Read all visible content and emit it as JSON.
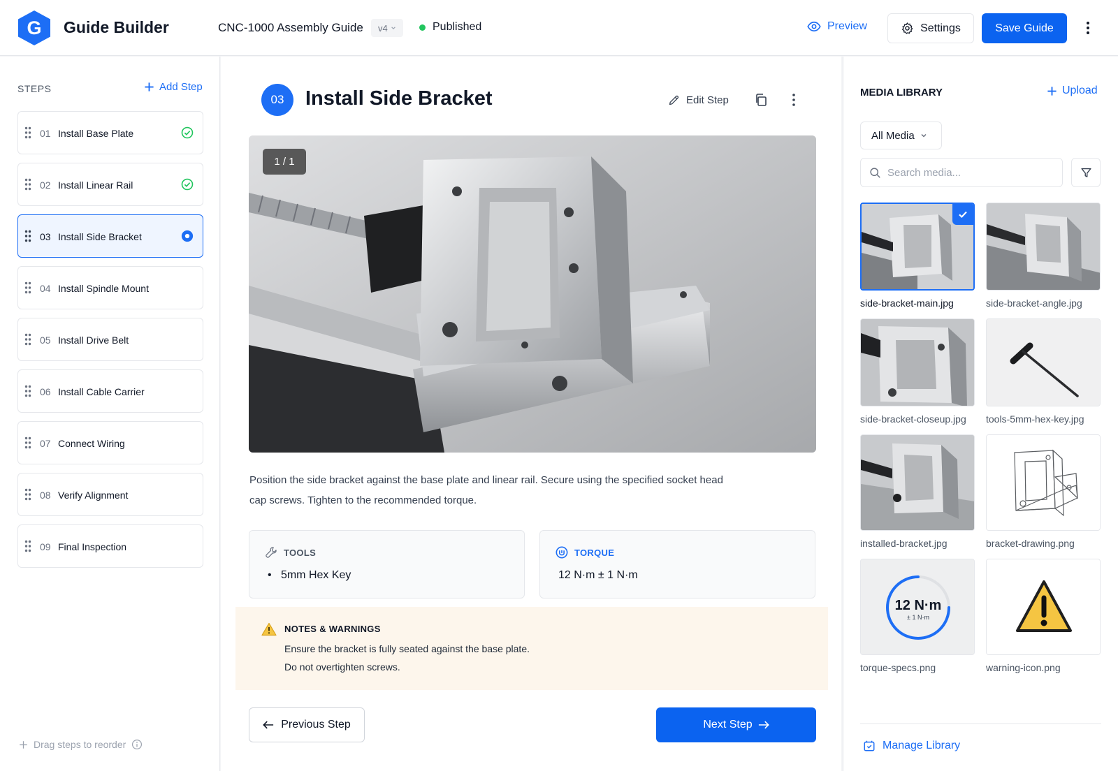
{
  "header": {
    "logo_letter": "G",
    "app_title": "Guide Builder",
    "doc_title": "CNC-1000 Assembly Guide",
    "version": "v4",
    "status": "Published",
    "preview_label": "Preview",
    "settings_label": "Settings",
    "save_label": "Save Guide"
  },
  "sidebar": {
    "title": "STEPS",
    "add_label": "Add Step",
    "steps": [
      {
        "num": "01",
        "label": "Install Base Plate",
        "state": "complete"
      },
      {
        "num": "02",
        "label": "Install Linear Rail",
        "state": "complete"
      },
      {
        "num": "03",
        "label": "Install Side Bracket",
        "state": "active"
      },
      {
        "num": "04",
        "label": "Install Spindle Mount",
        "state": "pending"
      },
      {
        "num": "05",
        "label": "Install Drive Belt",
        "state": "pending"
      },
      {
        "num": "06",
        "label": "Install Cable Carrier",
        "state": "pending"
      },
      {
        "num": "07",
        "label": "Connect Wiring",
        "state": "pending"
      },
      {
        "num": "08",
        "label": "Verify Alignment",
        "state": "pending"
      },
      {
        "num": "09",
        "label": "Final Inspection",
        "state": "pending"
      }
    ],
    "footer": "Drag steps to reorder"
  },
  "main": {
    "step_number": "03",
    "step_title": "Install Side Bracket",
    "edit_label": "Edit Step",
    "image_counter": "1 / 1",
    "description": "Position the side bracket against the base plate and linear rail. Secure using the specified socket head cap screws. Tighten to the recommended torque.",
    "tools": {
      "title": "TOOLS",
      "items": [
        "5mm Hex Key"
      ]
    },
    "torque": {
      "title": "TORQUE",
      "value": "12 N·m ± 1 N·m"
    },
    "notes": {
      "title": "NOTES & WARNINGS",
      "lines": [
        "Ensure the bracket is fully seated against the base plate.",
        "Do not overtighten screws."
      ]
    },
    "prev_label": "Previous Step",
    "next_label": "Next Step"
  },
  "media": {
    "title": "MEDIA LIBRARY",
    "upload_label": "Upload",
    "filter_value": "All Media",
    "search_placeholder": "Search media...",
    "items": [
      {
        "name": "side-bracket-main.jpg",
        "kind": "photo",
        "selected": true
      },
      {
        "name": "side-bracket-angle.jpg",
        "kind": "photo",
        "selected": false
      },
      {
        "name": "side-bracket-closeup.jpg",
        "kind": "photo",
        "selected": false
      },
      {
        "name": "tools-5mm-hex-key.jpg",
        "kind": "hex-key",
        "selected": false
      },
      {
        "name": "installed-bracket.jpg",
        "kind": "photo",
        "selected": false
      },
      {
        "name": "bracket-drawing.png",
        "kind": "drawing",
        "selected": false
      },
      {
        "name": "torque-specs.png",
        "kind": "torque",
        "selected": false,
        "big": "12 N·m",
        "small": "± 1 N·m"
      },
      {
        "name": "warning-icon.png",
        "kind": "warning",
        "selected": false
      }
    ],
    "manage_label": "Manage Library"
  },
  "colors": {
    "accent": "#1d6ef5",
    "primary_button": "#0b63f0",
    "success": "#22c55e",
    "warning": "#f5c542",
    "notes_bg": "#fdf6ec"
  }
}
